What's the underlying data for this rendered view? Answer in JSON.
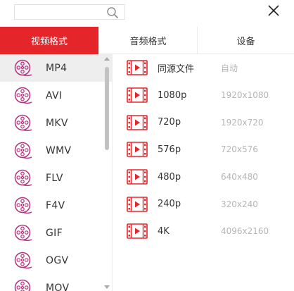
{
  "search": {
    "value": "",
    "placeholder": ""
  },
  "tabs": [
    {
      "label": "视频格式",
      "active": true
    },
    {
      "label": "音频格式",
      "active": false
    },
    {
      "label": "设备",
      "active": false
    }
  ],
  "formats": [
    {
      "label": "MP4",
      "selected": true
    },
    {
      "label": "AVI",
      "selected": false
    },
    {
      "label": "MKV",
      "selected": false
    },
    {
      "label": "WMV",
      "selected": false
    },
    {
      "label": "FLV",
      "selected": false
    },
    {
      "label": "F4V",
      "selected": false
    },
    {
      "label": "GIF",
      "selected": false
    },
    {
      "label": "OGV",
      "selected": false
    },
    {
      "label": "MOV",
      "selected": false
    }
  ],
  "resolutions": [
    {
      "label": "同源文件",
      "value": "自动"
    },
    {
      "label": "1080p",
      "value": "1920x1080"
    },
    {
      "label": "720p",
      "value": "1920x720"
    },
    {
      "label": "576p",
      "value": "720x576"
    },
    {
      "label": "480p",
      "value": "640x480"
    },
    {
      "label": "240p",
      "value": "320x240"
    },
    {
      "label": "4K",
      "value": "4096x2160"
    }
  ],
  "icons": {
    "search": "search-icon",
    "close": "close-icon",
    "format": "film-reel-icon",
    "resolution": "film-strip-icon"
  },
  "colors": {
    "accent": "#e4262b",
    "format_icon": "#b5307d",
    "muted_text": "#b5b5b5"
  }
}
